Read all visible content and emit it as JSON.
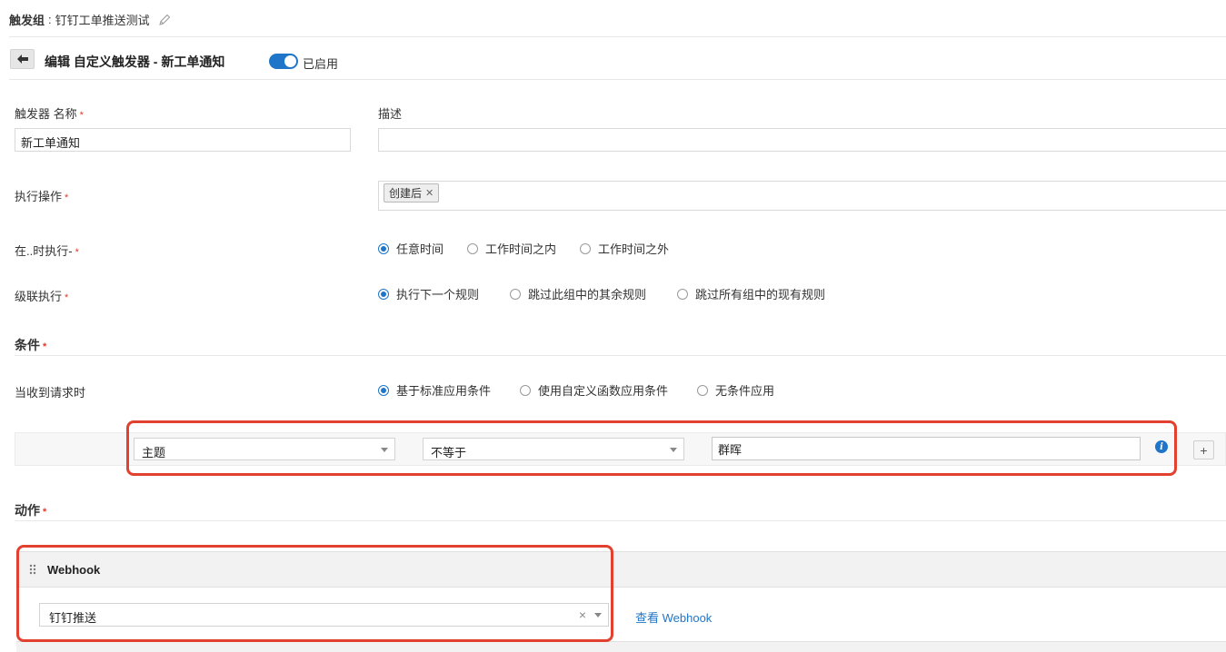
{
  "header": {
    "group_label": "触发组",
    "group_sep": ":",
    "group_name": "钉钉工单推送测试"
  },
  "titlebar": {
    "title": "编辑 自定义触发器 - 新工单通知",
    "toggle_label": "已启用",
    "toggle_on": true
  },
  "form": {
    "name_label": "触发器 名称",
    "name_value": "新工单通知",
    "desc_label": "描述",
    "desc_value": "",
    "action_label": "执行操作",
    "action_tags": [
      "创建后"
    ],
    "when_label": "在..时执行-",
    "when_options": [
      "任意时间",
      "工作时间之内",
      "工作时间之外"
    ],
    "when_selected": 0,
    "cascade_label": "级联执行",
    "cascade_options": [
      "执行下一个规则",
      "跳过此组中的其余规则",
      "跳过所有组中的现有规则"
    ],
    "cascade_selected": 0
  },
  "conditions": {
    "section_title": "条件",
    "request_label": "当收到请求时",
    "mode_options": [
      "基于标准应用条件",
      "使用自定义函数应用条件",
      "无条件应用"
    ],
    "mode_selected": 0,
    "rule": {
      "field": "主题",
      "operator": "不等于",
      "value": "群晖"
    },
    "info_icon": "info-icon",
    "add_label": "+"
  },
  "actions": {
    "section_title": "动作",
    "webhook_title": "Webhook",
    "webhook_value": "钉钉推送",
    "clear_label": "×",
    "view_link": "查看 Webhook"
  },
  "colors": {
    "accent": "#1f76c8",
    "required": "#e23b2e",
    "highlight_box": "#e2412f"
  }
}
